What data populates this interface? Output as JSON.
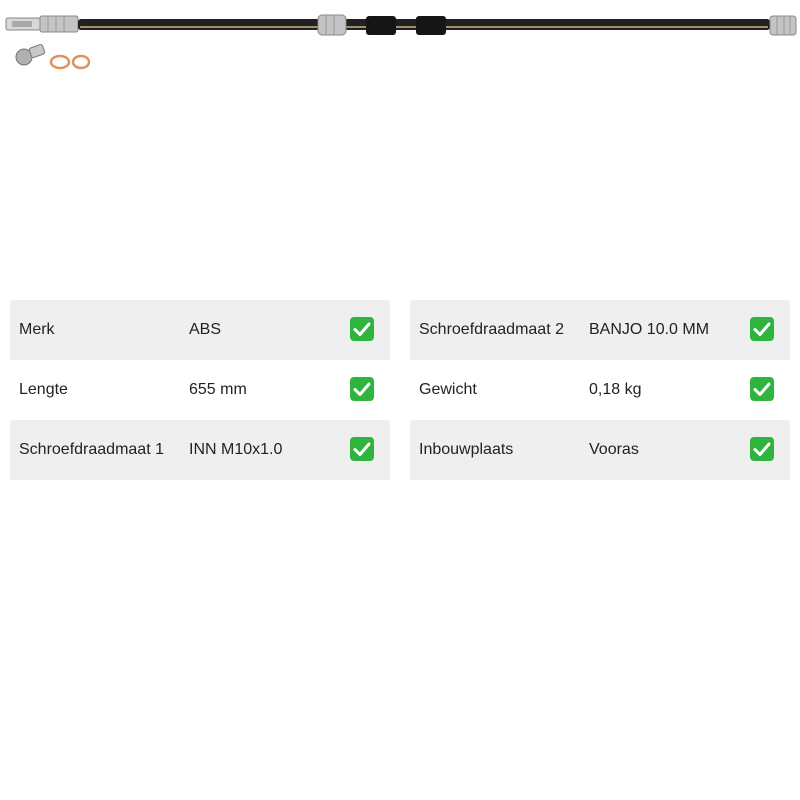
{
  "product_image": {
    "icon": "brake-hose-image",
    "hose_color": "#1f1f24",
    "stripe_color": "#c9b86a",
    "metal_color": "#c4c4c4",
    "washer_color": "#e0915a"
  },
  "specs": {
    "left": [
      {
        "label": "Merk",
        "value": "ABS",
        "status_icon": "checkmark-icon"
      },
      {
        "label": "Lengte",
        "value": "655 mm",
        "status_icon": "checkmark-icon"
      },
      {
        "label": "Schroefdraadmaat 1",
        "value": "INN M10x1.0",
        "status_icon": "checkmark-icon"
      }
    ],
    "right": [
      {
        "label": "Schroefdraadmaat 2",
        "value": "BANJO 10.0 MM",
        "status_icon": "checkmark-icon"
      },
      {
        "label": "Gewicht",
        "value": "0,18 kg",
        "status_icon": "checkmark-icon"
      },
      {
        "label": "Inbouwplaats",
        "value": "Vooras",
        "status_icon": "checkmark-icon"
      }
    ]
  },
  "colors": {
    "check_green": "#2fb53e",
    "row_shade": "#efefef"
  }
}
